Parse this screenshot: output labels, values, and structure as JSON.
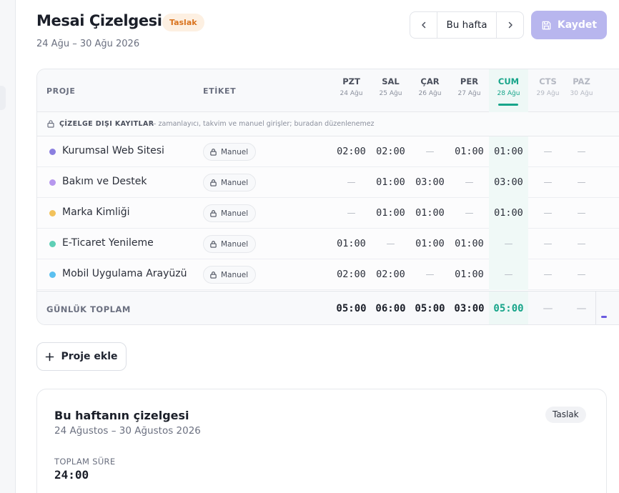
{
  "header": {
    "title": "Mesai Çizelgesi",
    "status_badge": "Taslak",
    "date_range": "24 Ağu – 30 Ağu 2026",
    "week_label": "Bu hafta",
    "save_label": "Kaydet"
  },
  "table": {
    "col_project": "PROJE",
    "col_tag": "ETİKET",
    "days": [
      {
        "name": "PZT",
        "date": "24 Ağu"
      },
      {
        "name": "SAL",
        "date": "25 Ağu"
      },
      {
        "name": "ÇAR",
        "date": "26 Ağu"
      },
      {
        "name": "PER",
        "date": "27 Ağu"
      },
      {
        "name": "CUM",
        "date": "28 Ağu"
      },
      {
        "name": "CTS",
        "date": "29 Ağu"
      },
      {
        "name": "PAZ",
        "date": "30 Ağu"
      }
    ],
    "today_index": 4,
    "weekend_indices": [
      5,
      6
    ],
    "section": {
      "title": "ÇİZELGE DIŞI KAYITLAR",
      "note": "— zamanlayıcı, takvim ve manuel girişler; buradan düzenlenemez"
    },
    "rows": [
      {
        "project": "Kurumsal Web Sitesi",
        "color": "#8b7fe0",
        "tag": "Manuel",
        "hours": [
          "02:00",
          "02:00",
          "—",
          "01:00",
          "01:00",
          "—",
          "—"
        ]
      },
      {
        "project": "Bakım ve Destek",
        "color": "#b697ee",
        "tag": "Manuel",
        "hours": [
          "—",
          "01:00",
          "03:00",
          "—",
          "03:00",
          "—",
          "—"
        ]
      },
      {
        "project": "Marka Kimliği",
        "color": "#f2c25c",
        "tag": "Manuel",
        "hours": [
          "—",
          "01:00",
          "01:00",
          "—",
          "01:00",
          "—",
          "—"
        ]
      },
      {
        "project": "E-Ticaret Yenileme",
        "color": "#5fcfb6",
        "tag": "Manuel",
        "hours": [
          "01:00",
          "—",
          "01:00",
          "01:00",
          "—",
          "—",
          "—"
        ]
      },
      {
        "project": "Mobil Uygulama Arayüzü",
        "color": "#5bc0f0",
        "tag": "Manuel",
        "hours": [
          "02:00",
          "02:00",
          "—",
          "01:00",
          "—",
          "—",
          "—"
        ]
      }
    ],
    "total_label": "GÜNLÜK TOPLAM",
    "totals": [
      "05:00",
      "06:00",
      "05:00",
      "03:00",
      "05:00",
      "—",
      "—"
    ]
  },
  "actions": {
    "add_project_label": "Proje ekle"
  },
  "summary": {
    "title": "Bu haftanın çizelgesi",
    "date_range": "24 Ağustos – 30 Ağustos 2026",
    "badge": "Taslak",
    "total_label": "TOPLAM SÜRE",
    "total_value": "24:00"
  },
  "icons": {
    "prev": "chevron-left-icon",
    "next": "chevron-right-icon",
    "save": "floppy-disk-icon",
    "lock": "lock-icon",
    "add": "plus-icon"
  },
  "colors": {
    "accent": "#b8b6ee",
    "today": "#17a58a",
    "draft_badge_bg": "#fdf0e2",
    "draft_badge_text": "#d9731e"
  }
}
